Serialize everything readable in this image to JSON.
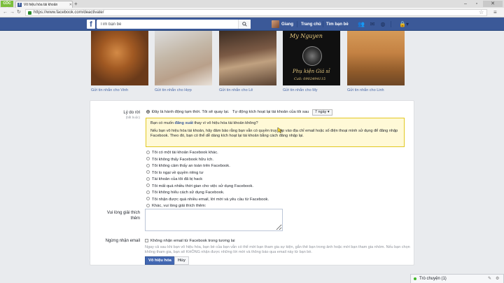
{
  "browser": {
    "logo_label": "CỐC CỐC",
    "tab_title": "Vô hiệu hóa tài khoản",
    "tab_favicon": "f",
    "url": "https://www.facebook.com/deactivate/",
    "new_tab_icon": "plus-icon"
  },
  "fb_header": {
    "logo": "f",
    "search_placeholder": "Tìm bạn bè",
    "user_name": "Giang",
    "home_label": "Trang chủ",
    "find_friends_label": "Tìm bạn bè"
  },
  "friends": [
    {
      "link": "Gửi tin nhắn cho Vinh"
    },
    {
      "link": "Gửi tin nhắn cho Hợp"
    },
    {
      "link": "Gửi tin nhắn cho Lê"
    },
    {
      "link": "Gửi tin nhắn cho My"
    },
    {
      "link": "Gửi tin nhắn cho Linh"
    }
  ],
  "photo_my": {
    "title": "My Nguyen",
    "subtitle": "Phụ kiện Giá sỉ",
    "phone": "Call: 0902494115"
  },
  "form": {
    "reason_label": "Lý do rời",
    "reason_required": "(bắt buộc)",
    "temporary_option": "Đây là hành động tạm thời. Tôi sẽ quay lại.",
    "auto_reactivate_text": "Tự động kích hoạt lại tài khoản của tôi sau",
    "auto_reactivate_value": "7 ngày",
    "notice_question_pre": "Bạn có muốn ",
    "notice_link": "đăng xuất",
    "notice_question_post": " thay vì vô hiệu hóa tài khoản không?",
    "notice_body": "Nếu bạn vô hiệu hóa tài khoản, hãy đảm bảo rằng bạn vẫn có quyền truy cập vào địa chỉ email hoặc số điện thoại mình sử dụng để đăng nhập Facebook. Theo đó, bạn có thể dễ dàng kích hoạt lại tài khoản bằng cách đăng nhập lại.",
    "options": [
      "Tôi có một tài khoản Facebook khác.",
      "Tôi không thấy Facebook hữu ích.",
      "Tôi không cảm thấy an toàn trên Facebook.",
      "Tôi lo ngại về quyền riêng tư",
      "Tài khoản của tôi đã bị hack",
      "Tôi mất quá nhiều thời gian cho việc sử dụng Facebook.",
      "Tôi không hiểu cách sử dụng Facebook.",
      "Tôi nhận được quá nhiều email, lời mời và yêu cầu từ Facebook.",
      "Khác, vui lòng giải thích thêm:"
    ],
    "explain_label_1": "Vui lòng giải thích",
    "explain_label_2": "thêm",
    "email_optout_label": "Ngừng nhận email",
    "email_optout_checkbox": "Không nhận email từ Facebook trong tương lai",
    "email_help": "Ngay cả sau khi bạn vô hiệu hóa, bạn bè của bạn vẫn có thể mời bạn tham gia sự kiện, gắn thẻ bạn trong ảnh hoặc mời bạn tham gia nhóm. Nếu bạn chọn không tham gia, bạn sẽ KHÔNG nhận được những lời mời và thông báo qua email này từ bạn bè.",
    "deactivate_button": "Vô hiệu hóa",
    "cancel_button": "Hủy"
  },
  "chat": {
    "label": "Trò chuyện (1)"
  },
  "colors": {
    "fb_blue": "#3b5998",
    "notice_bg": "#fff9d7",
    "online_green": "#42b72a"
  }
}
